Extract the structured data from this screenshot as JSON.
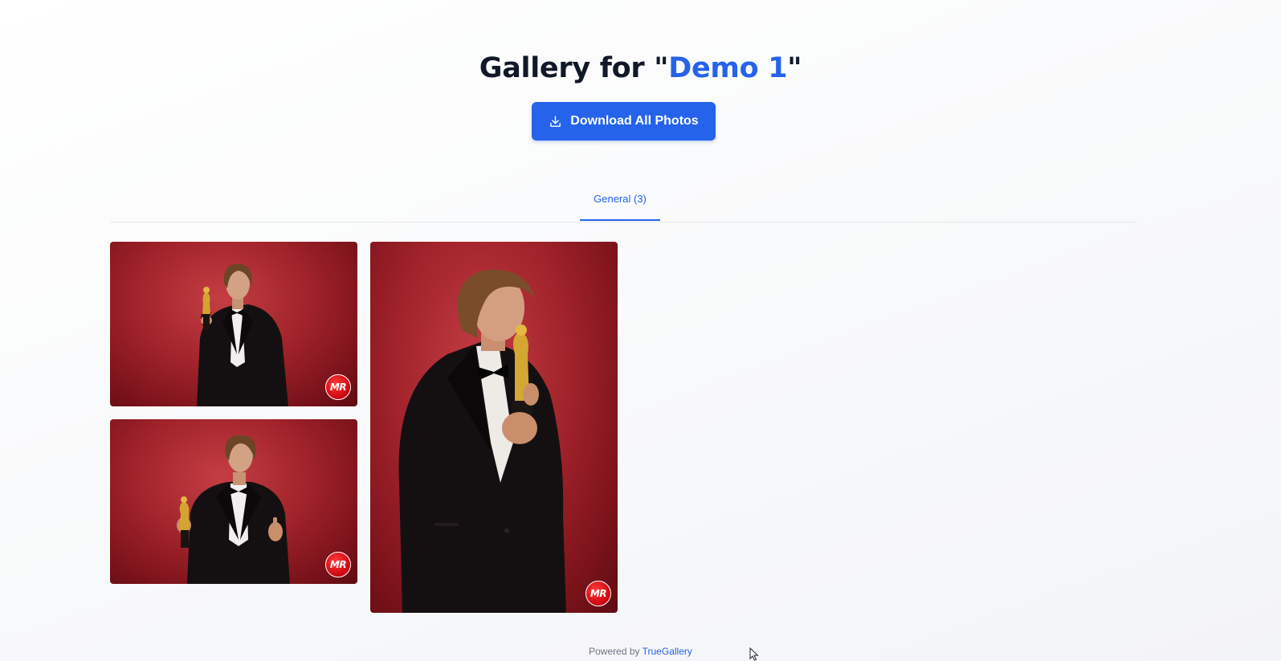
{
  "header": {
    "title_prefix": "Gallery for \"",
    "title_name": "Demo 1",
    "title_suffix": "\""
  },
  "download_button": {
    "label": "Download All Photos",
    "icon": "download-icon"
  },
  "tabs": [
    {
      "label": "General (3)",
      "active": true
    }
  ],
  "photos": [
    {
      "name": "photo-1",
      "watermark": "MR",
      "description": "man in tuxedo holding golden statuette"
    },
    {
      "name": "photo-2",
      "watermark": "MR",
      "description": "man in tuxedo kissing golden statuette"
    },
    {
      "name": "photo-3",
      "watermark": "MR",
      "description": "man in tuxedo holding statuette, gesturing"
    }
  ],
  "footer": {
    "prefix": "Powered by",
    "link": "TrueGallery"
  },
  "colors": {
    "accent": "#2563eb",
    "title": "#111827",
    "photo_background": "#a2232b",
    "watermark": "#d40b14"
  }
}
